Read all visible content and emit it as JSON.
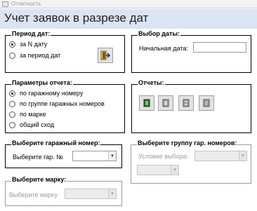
{
  "window": {
    "title": "Отчетность"
  },
  "header": {
    "title": "Учет заявок в разрезе дат"
  },
  "period_group": {
    "title": "Период дат:",
    "options": [
      {
        "label": "за N дату",
        "selected": true
      },
      {
        "label": "за период дат",
        "selected": false
      }
    ],
    "exit_icon": "exit-door-icon"
  },
  "date_group": {
    "title": "Выбор даты:",
    "start_label": "Начальная дата:",
    "start_value": ""
  },
  "params_group": {
    "title": "Параметры отчета:",
    "options": [
      {
        "label": "по гаражному номеру",
        "selected": true
      },
      {
        "label": "по группе гаражных номеров",
        "selected": false
      },
      {
        "label": "по марке",
        "selected": false
      },
      {
        "label": "общий сход",
        "selected": false
      }
    ]
  },
  "reports_group": {
    "title": "Отчеты:",
    "buttons": [
      "report-1-icon",
      "report-2-icon",
      "report-3-icon",
      "report-4-icon"
    ]
  },
  "garage_group": {
    "title": "Выберите гаражный номер:",
    "label": "Выберите гар. №",
    "value": ""
  },
  "garage_group_select": {
    "title": "Выберите группу гар. номеров:",
    "label": "Условие выбора:",
    "value": "",
    "second_value": ""
  },
  "brand_group": {
    "title": "Выберите марку:",
    "label": "Выберите марку",
    "value": ""
  },
  "colors": {
    "accent_band": "#dbe5f1",
    "disabled_text": "#9a9a9a"
  }
}
